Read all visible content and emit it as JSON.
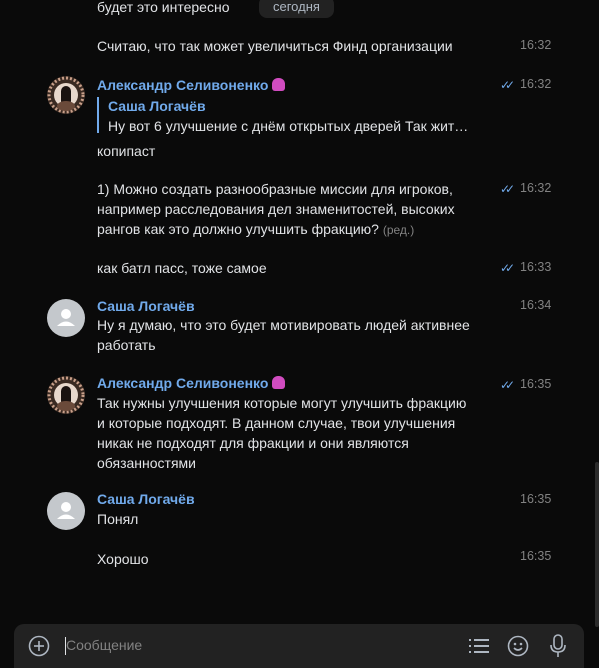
{
  "date_pill": "сегодня",
  "messages": [
    {
      "text": "будет это интересно"
    },
    {
      "text": "Считаю, что так может увеличиться Финд организации",
      "time": "16:32"
    },
    {
      "author": "Александр Селивоненко",
      "time": "16:32",
      "reply_author": "Саша Логачёв",
      "reply_text": "Ну вот 6 улучшение с днём открытых дверей Так жит…",
      "text": "копипаст"
    },
    {
      "lines": [
        "1) Можно создать разнообразные миссии для игроков,",
        "например расследования дел знаменитостей, высоких",
        "рангов как это должно улучшить фракцию?"
      ],
      "edited": "(ред.)",
      "time": "16:32"
    },
    {
      "text": "как батл пасс, тоже самое",
      "time": "16:33"
    },
    {
      "author": "Саша Логачёв",
      "time": "16:34",
      "lines": [
        "Ну я думаю, что это будет мотивировать людей активнее",
        "работать"
      ]
    },
    {
      "author": "Александр Селивоненко",
      "time": "16:35",
      "lines": [
        "Так нужны улучшения которые могут улучшить фракцию",
        "и которые подходят. В данном случае, твои улучшения",
        "никак не подходят для фракции и они являются",
        "обязанностями"
      ]
    },
    {
      "author": "Саша Логачёв",
      "time": "16:35",
      "text": "Понял"
    },
    {
      "text": "Хорошо",
      "time": "16:35"
    }
  ],
  "composer": {
    "placeholder": "Сообщение",
    "icons": [
      "plus-circle-icon",
      "list-icon",
      "smile-icon",
      "microphone-icon"
    ]
  },
  "colors": {
    "background": "#0a0a0a",
    "author": "#71aaeb",
    "text": "#e1e3e6",
    "time": "#828282",
    "composer": "#222222"
  }
}
